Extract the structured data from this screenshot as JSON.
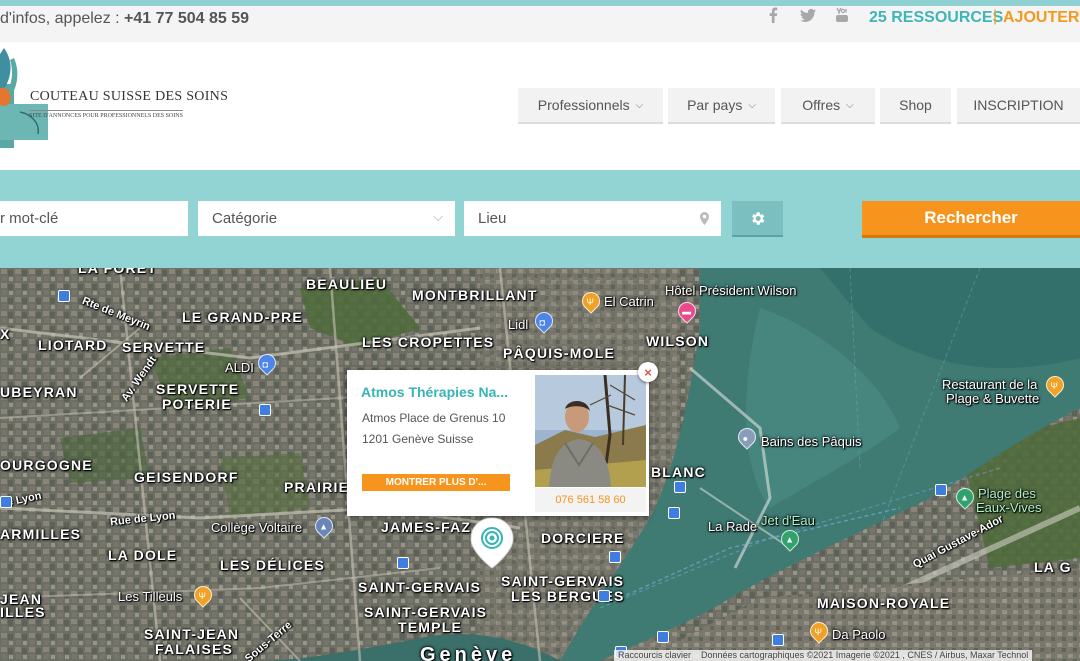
{
  "topbar": {
    "contact_text": "d'infos, appelez : ",
    "phone": "+41 77 504 85 59",
    "resources": "25 RESSOURCES",
    "separator": "|",
    "add": "AJOUTER"
  },
  "logo": {
    "title": "COUTEAU SUISSE DES SOINS",
    "subtitle": "SITE D'ANNONCES POUR PROFESSIONNELS DES SOINS"
  },
  "nav": {
    "professionals": "Professionnels",
    "by_country": "Par pays",
    "offers": "Offres",
    "shop": "Shop",
    "signup": "INSCRIPTION"
  },
  "search": {
    "keyword_placeholder": "r mot-clé",
    "category": "Catégorie",
    "location": "Lieu",
    "button": "Rechercher"
  },
  "map": {
    "labels": {
      "beaulieu": "BEAULIEU",
      "montbrillant": "MONTBRILLANT",
      "legrandpre": "LE GRAND-PRE",
      "liotard": "LIOTARD",
      "servette": "SERVETTE",
      "lescropettes": "LES CROPETTES",
      "paquismole": "PÂQUIS-MOLE",
      "wilson": "WILSON",
      "servettepoterie_1": "SERVETTE",
      "servettepoterie_2": "POTERIE",
      "ubeyran": "UBEYRAN",
      "ourgogne": "OURGOGNE",
      "geisendorf": "GEISENDORF",
      "prairie": "PRAIRIE",
      "blanc": "BLANC",
      "armilles": "ARMILLES",
      "jamesfazy": "JAMES-FAZ",
      "dorciere": "DORCIERE",
      "ladole": "LA DOLE",
      "lesdelices": "LES DÉLICES",
      "saintgervais": "SAINT-GERVAIS",
      "sgbergues_1": "SAINT-GERVAIS",
      "sgbergues_2": "LES BERGUES",
      "sgtemple_1": "SAINT-GERVAIS",
      "sgtemple_2": "TEMPLE",
      "jean_1": "JEAN",
      "jean_2": "ILLES",
      "sjfalaises_1": "SAINT-JEAN",
      "sjfalaises_2": "FALAISES",
      "maisonroyale": "MAISON-ROYALE",
      "lag": "LA G",
      "laforet": "LA FORET",
      "x": "X",
      "geneve": "Genève"
    },
    "pois": {
      "elcatrin": "El Catrin",
      "hotel": "Hôtel Président Wilson",
      "lidl": "Lidl",
      "aldi": "ALDI",
      "bains": "Bains des Pâquis",
      "restaurant_1": "Restaurant de la",
      "restaurant_2": "Plage & Buvette",
      "plage_1": "Plage des",
      "plage_2": "Eaux-Vives",
      "larade": "La Rade",
      "jetdeau": "Jet d'Eau",
      "college": "Collège Voltaire",
      "tilleuls": "Les Tilleuls",
      "dapaolo": "Da Paolo"
    },
    "streets": {
      "meyrin": "Rte de Meyrin",
      "wendt": "Av. Wendt",
      "lyon1": "de Lyon",
      "lyon2": "Rue de Lyon",
      "gustave": "Quai Gustave-Ador",
      "soustente": "Sous-Terre"
    },
    "attribution": {
      "shortcuts": "Raccourcis clavier",
      "data": "Données cartographiques ©2021 Imagerie ©2021 , CNES / Airbus, Maxar Technol"
    }
  },
  "popup": {
    "name": "Atmos Thérapies Na...",
    "address": "Atmos Place de Grenus 10",
    "city": "1201 Genève Suisse",
    "more": "MONTRER PLUS D'...",
    "phone": "076 561 58 60",
    "close": "×"
  },
  "colors": {
    "teal": "#37b4b6",
    "orange": "#f7941d",
    "band": "#92d3d4"
  },
  "icons": [
    "facebook-icon",
    "twitter-icon",
    "youtube-icon",
    "chevron-down-icon",
    "location-pin-icon",
    "gear-icon",
    "close-icon"
  ]
}
